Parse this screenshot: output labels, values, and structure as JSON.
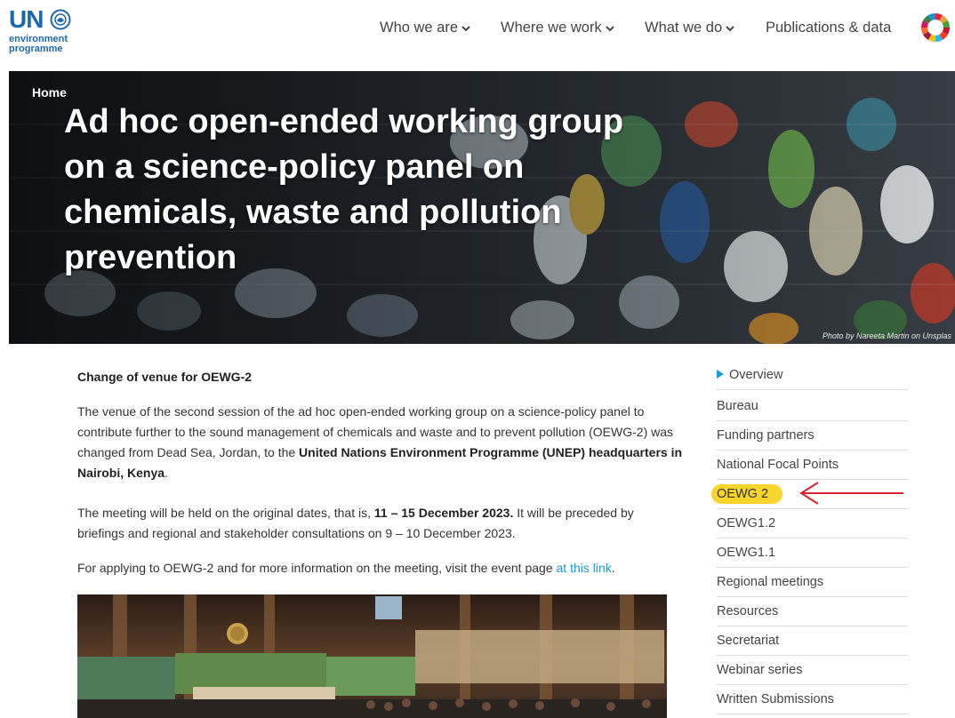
{
  "header": {
    "logo": {
      "mark": "UN",
      "line1": "environment",
      "line2": "programme"
    },
    "nav": [
      {
        "label": "Who we are",
        "has_dropdown": true
      },
      {
        "label": "Where we work",
        "has_dropdown": true
      },
      {
        "label": "What we do",
        "has_dropdown": true
      },
      {
        "label": "Publications & data",
        "has_dropdown": false
      }
    ],
    "sdg_icon": "sdg-wheel-icon"
  },
  "hero": {
    "breadcrumb": "Home",
    "title": "Ad hoc open-ended working group on a science-policy panel on chemicals, waste and pollution prevention",
    "photo_credit": "Photo by Nareeta Martin on Unsplas"
  },
  "main": {
    "section_title": "Change of venue for OEWG-2",
    "p1_a": "The venue of the second session of the ad hoc open-ended working group on a science-policy panel to contribute further to the sound management of chemicals and waste and to prevent pollution (OEWG-2) was changed from Dead Sea, Jordan, to the ",
    "p1_bold": "United Nations Environment Programme (UNEP) headquarters in Nairobi, Kenya",
    "p1_end": ".",
    "p2_a": "The meeting will be held on the original dates, that is, ",
    "p2_bold": "11 – 15 December 2023.",
    "p2_b": " It will be preceded by briefings and regional and stakeholder consultations on 9 – 10 December 2023.",
    "p3_a": "For applying to OEWG-2 and for more information on the meeting, visit the event page ",
    "p3_link": "at this link",
    "p3_end": "."
  },
  "sidebar": {
    "items": [
      {
        "label": "Overview",
        "current": true
      },
      {
        "label": "Bureau"
      },
      {
        "label": "Funding partners"
      },
      {
        "label": "National Focal Points"
      },
      {
        "label": "OEWG 2",
        "highlighted": true
      },
      {
        "label": "OEWG1.2"
      },
      {
        "label": "OEWG1.1"
      },
      {
        "label": "Regional meetings"
      },
      {
        "label": "Resources"
      },
      {
        "label": "Secretariat"
      },
      {
        "label": "Webinar series"
      },
      {
        "label": "Written Submissions"
      }
    ]
  },
  "colors": {
    "brand_blue": "#1b6ab1",
    "link_blue": "#1a9bd7",
    "highlight_yellow": "#f7d52a",
    "annotation_red": "#d9232e"
  }
}
